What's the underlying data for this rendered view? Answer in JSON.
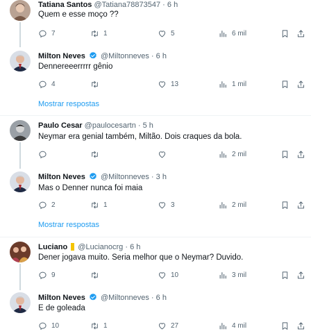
{
  "tweets": [
    {
      "name": "Tatiana Santos",
      "handle": "@Tatiana78873547",
      "sep": "·",
      "time": "6 h",
      "verified": false,
      "text": "Quem e esse moço ??",
      "replies": "7",
      "retweets": "1",
      "likes": "5",
      "views": "6 mil"
    },
    {
      "name": "Milton Neves",
      "handle": "@Miltonneves",
      "sep": "·",
      "time": "6 h",
      "verified": true,
      "text": "Dennereeerrrrr gênio",
      "replies": "4",
      "retweets": "",
      "likes": "13",
      "views": "1 mil"
    },
    {
      "name": "Paulo Cesar",
      "handle": "@paulocesartn",
      "sep": "·",
      "time": "5 h",
      "verified": false,
      "text": "Neymar era genial também, Miltão. Dois craques da bola.",
      "replies": "",
      "retweets": "",
      "likes": "",
      "views": "2 mil"
    },
    {
      "name": "Milton Neves",
      "handle": "@Miltonneves",
      "sep": "·",
      "time": "3 h",
      "verified": true,
      "text": "Mas o Denner nunca foi maia",
      "replies": "2",
      "retweets": "1",
      "likes": "3",
      "views": "2 mil"
    },
    {
      "name": "Luciano",
      "handle": "@Lucianocrg",
      "sep": "·",
      "time": "6 h",
      "verified": false,
      "text": "Dener jogava muito. Seria melhor que o Neymar? Duvido.",
      "replies": "9",
      "retweets": "",
      "likes": "10",
      "views": "3 mil"
    },
    {
      "name": "Milton Neves",
      "handle": "@Miltonneves",
      "sep": "·",
      "time": "6 h",
      "verified": true,
      "text": "E de goleada",
      "replies": "10",
      "retweets": "1",
      "likes": "27",
      "views": "4 mil"
    }
  ],
  "show_more_label": "Mostrar respostas",
  "colors": {
    "accent": "#1d9bf0",
    "muted": "#536471",
    "divider": "#eff3f4",
    "thread": "#cfd9de"
  }
}
